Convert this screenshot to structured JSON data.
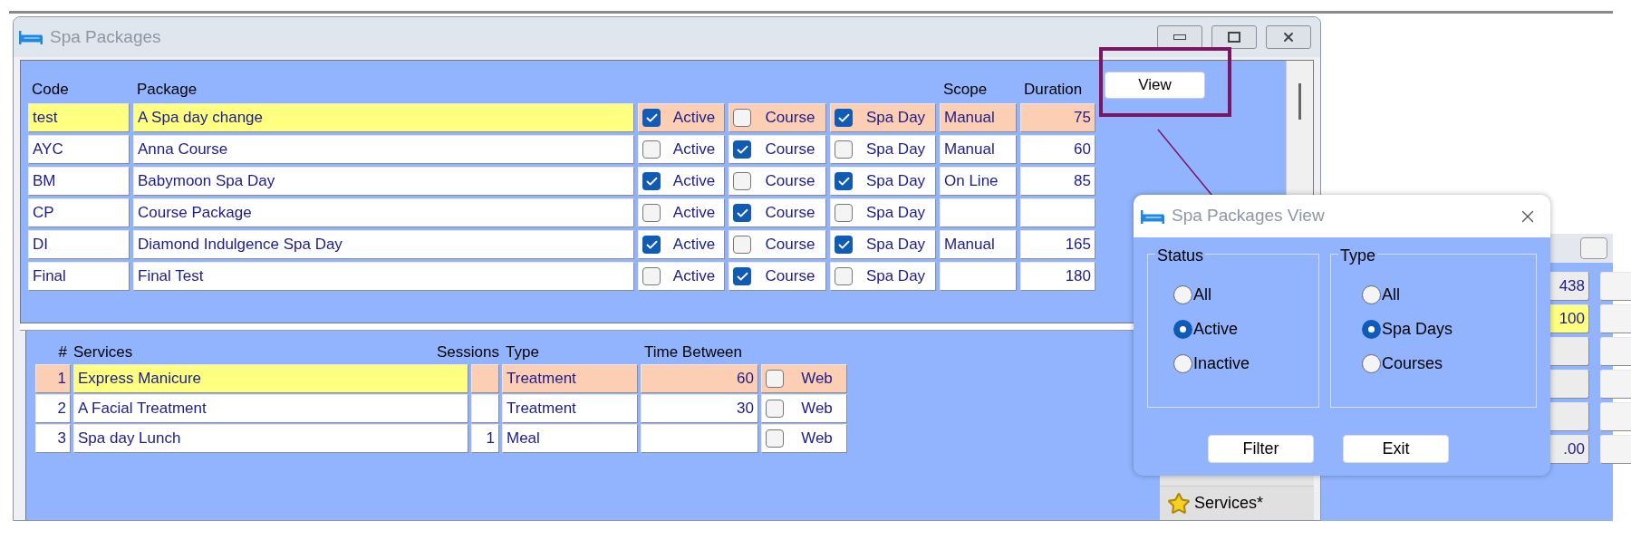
{
  "main_window": {
    "title": "Spa Packages",
    "view_button": "View",
    "packages": {
      "columns": [
        "Code",
        "Package",
        "Scope",
        "Duration"
      ],
      "rows": [
        {
          "code": "test",
          "package": "A Spa day change",
          "active": {
            "label": "Active",
            "checked": true
          },
          "course": {
            "label": "Course",
            "checked": false
          },
          "spa_day": {
            "label": "Spa Day",
            "checked": true
          },
          "scope": "Manual",
          "duration": "75",
          "selected": true
        },
        {
          "code": "AYC",
          "package": "Anna Course",
          "active": {
            "label": "Active",
            "checked": false
          },
          "course": {
            "label": "Course",
            "checked": true
          },
          "spa_day": {
            "label": "Spa Day",
            "checked": false
          },
          "scope": "Manual",
          "duration": "60",
          "selected": false
        },
        {
          "code": "BM",
          "package": "Babymoon Spa Day",
          "active": {
            "label": "Active",
            "checked": true
          },
          "course": {
            "label": "Course",
            "checked": false
          },
          "spa_day": {
            "label": "Spa Day",
            "checked": true
          },
          "scope": "On Line",
          "duration": "85",
          "selected": false
        },
        {
          "code": "CP",
          "package": "Course Package",
          "active": {
            "label": "Active",
            "checked": false
          },
          "course": {
            "label": "Course",
            "checked": true
          },
          "spa_day": {
            "label": "Spa Day",
            "checked": false
          },
          "selected": false
        },
        {
          "code": "DI",
          "package": "Diamond Indulgence Spa Day",
          "active": {
            "label": "Active",
            "checked": true
          },
          "course": {
            "label": "Course",
            "checked": false
          },
          "spa_day": {
            "label": "Spa Day",
            "checked": true
          },
          "scope": "Manual",
          "duration": "165",
          "selected": false
        },
        {
          "code": "Final",
          "package": "Final Test",
          "active": {
            "label": "Active",
            "checked": false
          },
          "course": {
            "label": "Course",
            "checked": true
          },
          "spa_day": {
            "label": "Spa Day",
            "checked": false
          },
          "duration": "180",
          "selected": false
        }
      ]
    },
    "services": {
      "columns": [
        "#",
        "Services",
        "Sessions",
        "Type",
        "Time Between"
      ],
      "rows": [
        {
          "number": "1",
          "service": "Express Manicure",
          "type": "Treatment",
          "time_between": "60",
          "web": {
            "label": "Web",
            "checked": false
          },
          "selected": true
        },
        {
          "number": "2",
          "service": "A Facial Treatment",
          "type": "Treatment",
          "time_between": "30",
          "web": {
            "label": "Web",
            "checked": false
          },
          "selected": false
        },
        {
          "number": "3",
          "service": "Spa day Lunch",
          "sessions": "1",
          "type": "Meal",
          "web": {
            "label": "Web",
            "checked": false
          },
          "selected": false
        }
      ]
    },
    "side_tab": "Services*"
  },
  "background_window": {
    "cells": [
      {
        "value": "438",
        "highlighted": false
      },
      {
        "value": "100",
        "highlighted": true
      },
      {},
      {},
      {},
      {
        "value": ".00",
        "highlighted": false
      }
    ]
  },
  "dialog": {
    "title": "Spa Packages View",
    "groups": [
      {
        "label": "Status",
        "options": [
          {
            "label": "All",
            "selected": false
          },
          {
            "label": "Active",
            "selected": true
          },
          {
            "label": "Inactive",
            "selected": false
          }
        ]
      },
      {
        "label": "Type",
        "options": [
          {
            "label": "All",
            "selected": false
          },
          {
            "label": "Spa Days",
            "selected": true
          },
          {
            "label": "Courses",
            "selected": false
          }
        ]
      }
    ],
    "buttons": [
      "Filter",
      "Exit"
    ]
  }
}
